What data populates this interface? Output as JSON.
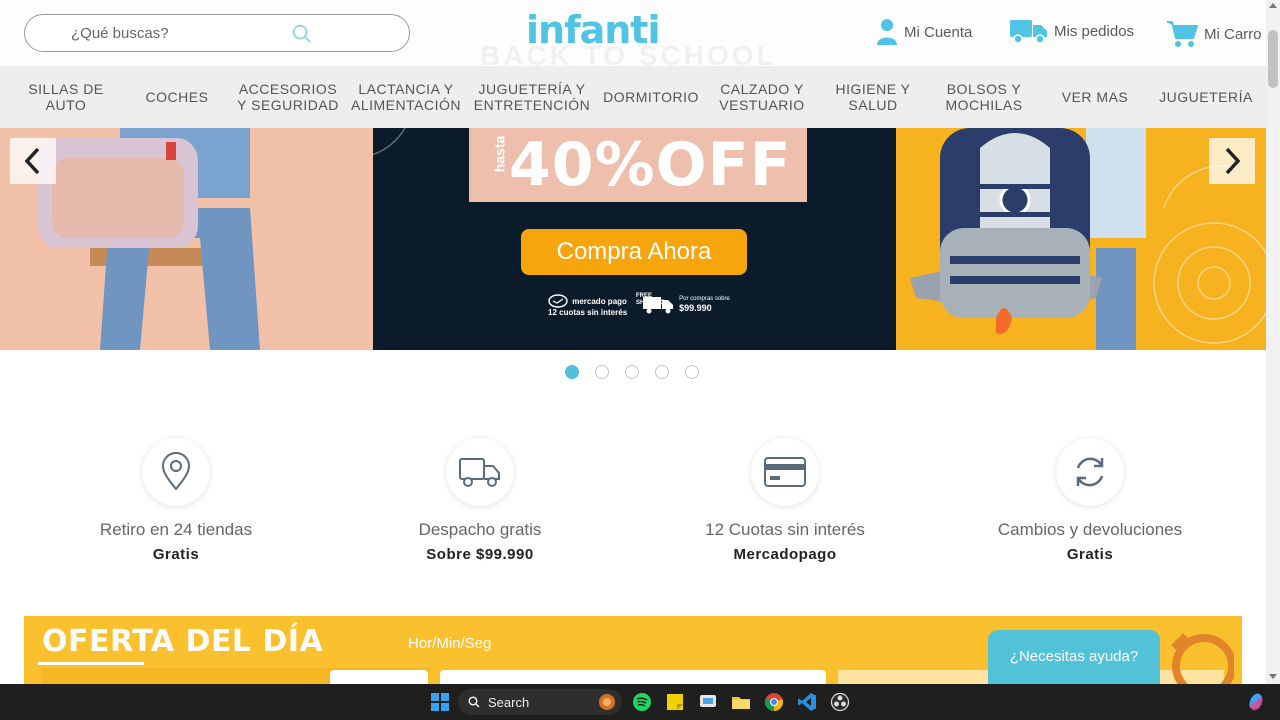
{
  "header": {
    "search_placeholder": "¿Qué buscas?",
    "logo": "infanti",
    "background_text": "BACK TO SCHOOL",
    "account_label": "Mi Cuenta",
    "orders_label": "Mis pedidos",
    "cart_label": "Mi Carro"
  },
  "nav": [
    {
      "label": "SILLAS DE AUTO"
    },
    {
      "label": "COCHES"
    },
    {
      "label": "ACCESORIOS Y SEGURIDAD"
    },
    {
      "label": "LACTANCIA Y ALIMENTACIÓN"
    },
    {
      "label": "JUGUETERÍA Y ENTRETENCIÓN"
    },
    {
      "label": "DORMITORIO"
    },
    {
      "label": "CALZADO Y VESTUARIO"
    },
    {
      "label": "HIGIENE Y SALUD"
    },
    {
      "label": "BOLSOS Y MOCHILAS"
    },
    {
      "label": "VER MAS"
    },
    {
      "label": "JUGUETERÍA"
    }
  ],
  "banner": {
    "promo_prefix": "hasta",
    "promo_text": "40%OFF",
    "cta_label": "Compra Ahora",
    "badge_mp_name": "mercado pago",
    "badge_mp_text": "12 cuotas sin interés",
    "badge_free": "FREE SHIPPING",
    "badge_shipping_text": "Por compras sobre",
    "badge_shipping_amount": "$99.990",
    "slides_total": 5,
    "active_slide": 1
  },
  "features": [
    {
      "icon": "location-pin-icon",
      "title": "Retiro en 24 tiendas",
      "subtitle": "Gratis"
    },
    {
      "icon": "truck-icon",
      "title": "Despacho gratis",
      "subtitle": "Sobre $99.990"
    },
    {
      "icon": "credit-card-icon",
      "title": "12 Cuotas sin interés",
      "subtitle": "Mercadopago"
    },
    {
      "icon": "refresh-icon",
      "title": "Cambios y devoluciones",
      "subtitle": "Gratis"
    }
  ],
  "oferta": {
    "title": "OFERTA DEL DÍA",
    "timer_label": "Hor/Min/Seg"
  },
  "help_button": "¿Necesitas ayuda?",
  "taskbar": {
    "search_label": "Search"
  },
  "colors": {
    "brand": "#4fc4e4",
    "cta": "#f7a50c",
    "oferta_bg": "#fbc02d",
    "dot_active": "#52c0dc"
  }
}
